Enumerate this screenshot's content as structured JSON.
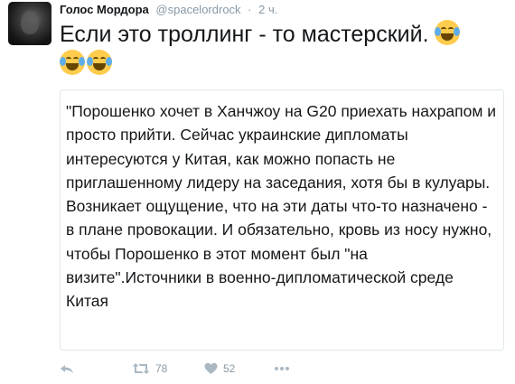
{
  "tweet": {
    "display_name": "Голос Мордора",
    "username": "@spacelordrock",
    "separator": "·",
    "time": "2 ч.",
    "text": "Если это троллинг - то мастерский.",
    "emojis": [
      "face-with-tears-of-joy",
      "face-with-tears-of-joy",
      "face-with-tears-of-joy"
    ]
  },
  "quote": {
    "text": "\"Порошенко хочет в Ханчжоу на G20 приехать нахрапом и просто прийти. Сейчас украинские дипломаты интересуются у Китая, как можно попасть не приглашенному лидеру на заседания, хотя бы в кулуары. Возникает ощущение, что на эти даты что-то назначено - в плане провокации. И обязательно, кровь из носу нужно, чтобы Порошенко в этот момент был \"на визите\".Источники в военно-дипломатической среде Китая"
  },
  "actions": {
    "reply_icon": "reply-icon",
    "retweet_icon": "retweet-icon",
    "retweet_count": "78",
    "like_icon": "heart-icon",
    "like_count": "52",
    "more_icon": "more-dots-icon"
  },
  "colors": {
    "text": "#14171a",
    "muted": "#8899a6",
    "border": "#e1e8ed",
    "emoji_face": "#ffcc4d"
  }
}
